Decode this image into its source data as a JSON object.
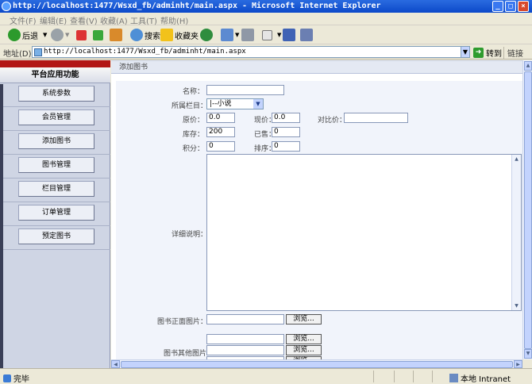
{
  "window": {
    "title": "http://localhost:1477/Wsxd_fb/adminht/main.aspx - Microsoft Internet Explorer",
    "min_glyph": "_",
    "max_glyph": "□",
    "close_glyph": "×"
  },
  "menu": [
    "文件(F)",
    "编辑(E)",
    "查看(V)",
    "收藏(A)",
    "工具(T)",
    "帮助(H)"
  ],
  "toolbar": {
    "back": "后退",
    "search": "搜索",
    "favorites": "收藏夹"
  },
  "address": {
    "label": "地址(D)",
    "url": "http://localhost:1477/Wsxd_fb/adminht/main.aspx",
    "go": "转到",
    "links": "链接"
  },
  "sidebar": {
    "title": "平台应用功能",
    "items": [
      "系统参数",
      "会员管理",
      "添加图书",
      "图书管理",
      "栏目管理",
      "订单管理",
      "预定图书"
    ]
  },
  "main": {
    "header": "添加图书",
    "fields": {
      "name_label": "名称：",
      "name_value": "",
      "column_label": "所属栏目：",
      "column_value": "|--小说",
      "original_price_label": "原价：",
      "original_price_value": "0.0",
      "current_price_label": "现价：",
      "current_price_value": "0.0",
      "compare_price_label": "对比价：",
      "compare_price_value": "",
      "stock_label": "库存：",
      "stock_value": "200",
      "sold_label": "已售：",
      "sold_value": "0",
      "points_label": "积分：",
      "points_value": "0",
      "sort_label": "排序：",
      "sort_value": "0",
      "detail_label": "详细说明：",
      "front_image_label": "图书正面图片：",
      "other_images_label": "图书其他图片",
      "browse": "浏览..."
    }
  },
  "status": {
    "left": "完毕",
    "zone": "本地 Intranet"
  }
}
